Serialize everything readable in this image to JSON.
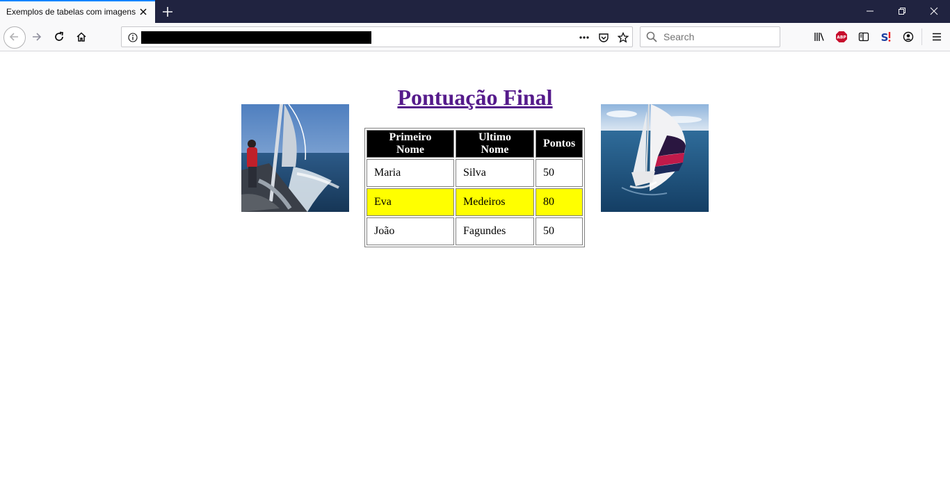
{
  "browser": {
    "tab": {
      "title": "Exemplos de tabelas com imagens"
    },
    "search": {
      "placeholder": "Search"
    },
    "colors": {
      "tab_accent": "#0a84ff",
      "titlebar": "#202340"
    },
    "icons": [
      "back-icon",
      "forward-icon",
      "reload-icon",
      "home-icon",
      "info-icon",
      "more-icon",
      "pocket-icon",
      "bookmark-star-icon",
      "search-icon",
      "library-icon",
      "adblock-icon",
      "sidebar-icon",
      "extension-icon",
      "account-icon",
      "menu-icon",
      "minimize-icon",
      "restore-icon",
      "close-icon",
      "new-tab-icon"
    ]
  },
  "page": {
    "title": "Pontuação Final",
    "title_color": "#551a8b",
    "table": {
      "headers": [
        "Primeiro Nome",
        "Ultimo Nome",
        "Pontos"
      ],
      "rows": [
        {
          "first": "Maria",
          "last": "Silva",
          "points": "50",
          "highlight": false
        },
        {
          "first": "Eva",
          "last": "Medeiros",
          "points": "80",
          "highlight": true
        },
        {
          "first": "João",
          "last": "Fagundes",
          "points": "50",
          "highlight": false
        }
      ],
      "header_bg": "#000000",
      "highlight_color": "#ffff00"
    },
    "images": [
      {
        "name": "sailboat-crew-photo"
      },
      {
        "name": "sailboat-spinnaker-photo"
      }
    ]
  }
}
